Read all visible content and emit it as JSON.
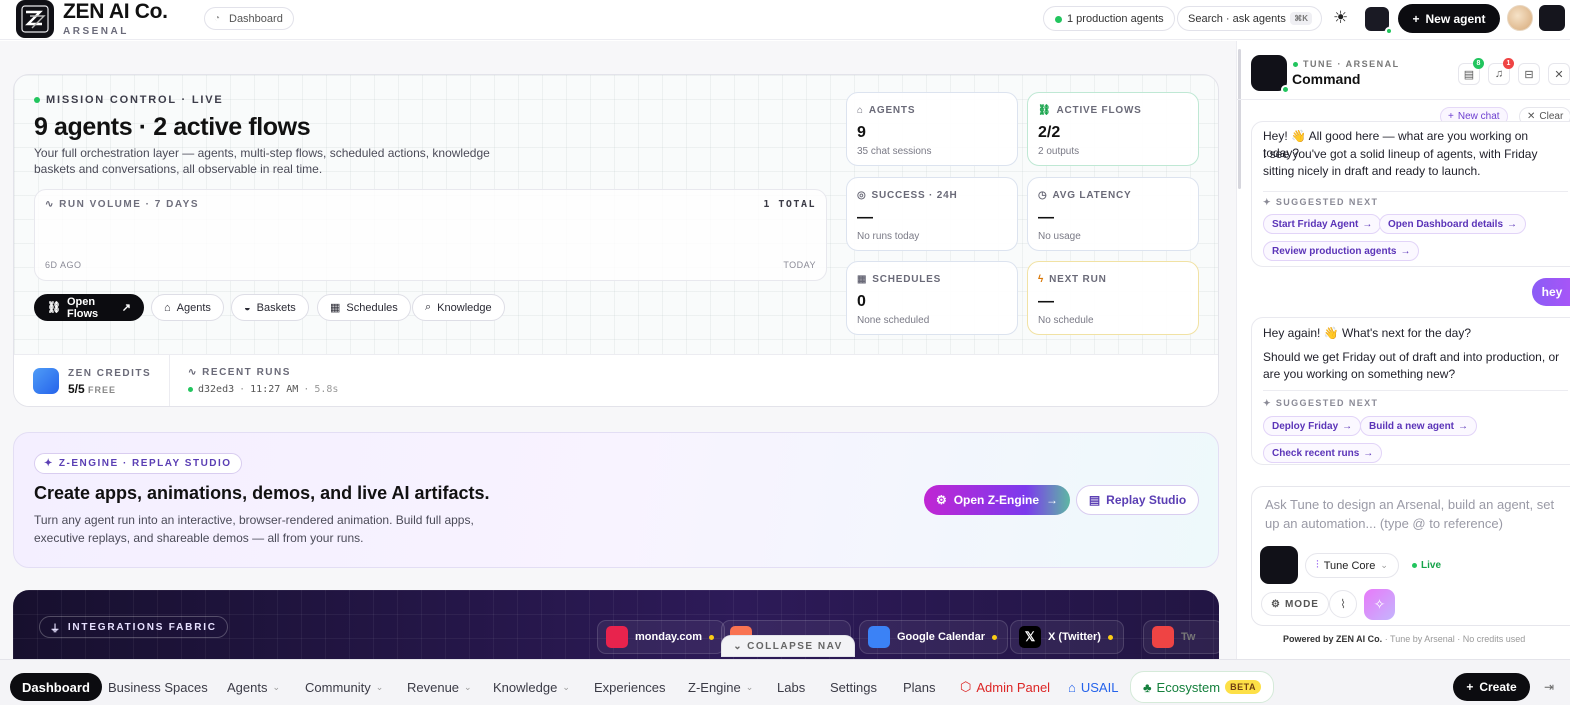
{
  "header": {
    "brand_title": "ZEN AI Co.",
    "brand_subtitle": "ARSENAL",
    "breadcrumb": "Dashboard",
    "production_agents": "1 production agents",
    "search_placeholder": "Search · ask agents",
    "search_shortcut": "⌘K",
    "new_agent_label": "New agent"
  },
  "mission": {
    "label": "MISSION CONTROL · LIVE",
    "title": "9 agents · 2 active flows",
    "description": "Your full orchestration layer — agents, multi-step flows, scheduled actions, knowledge baskets and conversations, all observable in real time.",
    "run_volume_label": "RUN VOLUME · 7 DAYS",
    "run_volume_total": "1 TOTAL",
    "range_start": "6D AGO",
    "range_end": "TODAY",
    "quick_links": [
      {
        "label": "Open Flows",
        "icon": "flow-icon"
      },
      {
        "label": "Agents",
        "icon": "robot-icon"
      },
      {
        "label": "Baskets",
        "icon": "basket-icon"
      },
      {
        "label": "Schedules",
        "icon": "calendar-icon"
      },
      {
        "label": "Knowledge",
        "icon": "knowledge-icon"
      }
    ],
    "stats": [
      {
        "label": "AGENTS",
        "value": "9",
        "sub": "35 chat sessions"
      },
      {
        "label": "ACTIVE FLOWS",
        "value": "2/2",
        "sub": "2 outputs"
      },
      {
        "label": "SUCCESS · 24H",
        "value": "—",
        "sub": "No runs today"
      },
      {
        "label": "AVG LATENCY",
        "value": "—",
        "sub": "No usage"
      },
      {
        "label": "SCHEDULES",
        "value": "0",
        "sub": "None scheduled"
      },
      {
        "label": "NEXT RUN",
        "value": "—",
        "sub": "No schedule"
      }
    ],
    "credits_label": "ZEN CREDITS",
    "credits_value": "5/5",
    "credits_plan": "FREE",
    "recent_runs_label": "RECENT RUNS",
    "recent_run": {
      "id": "d32ed3",
      "time": "11:27 AM",
      "duration": "5.8s"
    }
  },
  "zengine": {
    "tag": "Z-ENGINE · REPLAY STUDIO",
    "title": "Create apps, animations, demos, and live AI artifacts.",
    "description": "Turn any agent run into an interactive, browser-rendered animation. Build full apps, executive replays, and shareable demos — all from your runs.",
    "open_label": "Open Z-Engine",
    "replay_label": "Replay Studio"
  },
  "integrations": {
    "tag": "INTEGRATIONS FABRIC",
    "chips": [
      "monday.com",
      "",
      "Google Calendar",
      "X (Twitter)",
      "Tw"
    ],
    "collapse_label": "COLLAPSE NAV"
  },
  "panel": {
    "subtitle": "TUNE · ARSENAL",
    "title": "Command",
    "badge_docs": "8",
    "badge_alerts": "1",
    "new_chat": "New chat",
    "clear": "Clear",
    "messages": [
      {
        "text1": "Hey! 👋 All good here — what are you working on today?",
        "text2": "I see you've got a solid lineup of agents, with Friday sitting nicely in draft and ready to launch.",
        "suggested_label": "SUGGESTED NEXT",
        "chips": [
          "Start Friday Agent",
          "Open Dashboard details",
          "Review production agents"
        ]
      },
      {
        "text1": "Hey again! 👋 What's next for the day?",
        "text2": "Should we get Friday out of draft and into production, or are you working on something new?",
        "suggested_label": "SUGGESTED NEXT",
        "chips": [
          "Deploy Friday",
          "Build a new agent",
          "Check recent runs"
        ]
      }
    ],
    "user_message": "hey",
    "composer_placeholder": "Ask Tune to design an Arsenal, build an agent, set up an automation... (type @ to reference)",
    "model": "Tune Core",
    "status": "Live",
    "mode_label": "MODE",
    "powered_by_brand": "Powered by ZEN AI Co.",
    "powered_by_note": "· Tune by Arsenal · No credits used"
  },
  "bottom_nav": {
    "items": [
      "Dashboard",
      "Business Spaces",
      "Agents",
      "Community",
      "Revenue",
      "Knowledge",
      "Experiences",
      "Z-Engine",
      "Labs",
      "Settings",
      "Plans",
      "Admin Panel",
      "USAIL",
      "Ecosystem"
    ],
    "beta": "BETA",
    "create_label": "Create"
  },
  "colors": {
    "accent": "#0c0c10",
    "live": "#22c55e",
    "purple": "#7c3aed",
    "admin": "#dc2626",
    "usail": "#2563eb"
  }
}
